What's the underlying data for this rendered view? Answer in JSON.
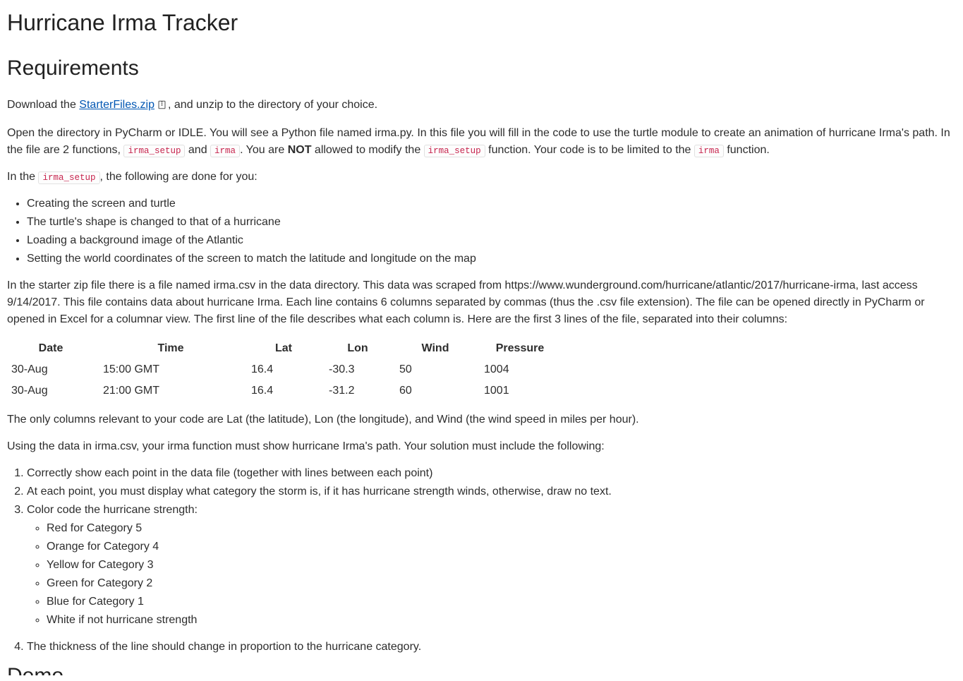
{
  "title": "Hurricane Irma Tracker",
  "heading_requirements": "Requirements",
  "p_download_pre": "Download the ",
  "link_starter": "StarterFiles.zip",
  "p_download_post": ", and unzip to the directory of your choice.",
  "p_open_pre": "Open the directory in PyCharm or IDLE. You will see a Python file named irma.py. In this file you will fill in the code to use the turtle module to create an animation of hurricane Irma's path. In the file are 2 functions, ",
  "code_irma_setup": "irma_setup",
  "p_open_mid1": " and ",
  "code_irma": "irma",
  "p_open_mid2": ". You are ",
  "bold_not": "NOT",
  "p_open_mid3": " allowed to modify the ",
  "p_open_mid4": " function. Your code is to be limited to the ",
  "p_open_end": " function.",
  "p_inthe_pre": "In the ",
  "p_inthe_post": ", the following are done for you:",
  "setup_items": [
    "Creating the screen and turtle",
    "The turtle's shape is changed to that of a hurricane",
    "Loading a background image of the Atlantic",
    "Setting the world coordinates of the screen to match the latitude and longitude on the map"
  ],
  "p_csv": "In the starter zip file there is a file named irma.csv in the data directory. This data was scraped from https://www.wunderground.com/hurricane/atlantic/2017/hurricane-irma, last access 9/14/2017. This file contains data about hurricane Irma. Each line contains 6 columns separated by commas (thus the .csv file extension). The file can be opened directly in PyCharm or opened in Excel for a columnar view. The first line of the file describes what each column is. Here are the first 3 lines of the file, separated into their columns:",
  "table_headers": [
    "Date",
    "Time",
    "Lat",
    "Lon",
    "Wind",
    "Pressure"
  ],
  "table_rows": [
    [
      "30-Aug",
      "15:00 GMT",
      "16.4",
      "-30.3",
      "50",
      "1004"
    ],
    [
      "30-Aug",
      "21:00 GMT",
      "16.4",
      "-31.2",
      "60",
      "1001"
    ]
  ],
  "p_relevant": "The only columns relevant to your code are Lat (the latitude), Lon (the longitude), and Wind (the wind speed in miles per hour).",
  "p_using": "Using the data in irma.csv, your irma function must show hurricane Irma's path. Your solution must include the following:",
  "req_items": {
    "r1": "Correctly show each point in the data file (together with lines between each point)",
    "r2": "At each point, you must display what category the storm is, if it has hurricane strength winds, otherwise, draw no text.",
    "r3": "Color code the hurricane strength:",
    "r4": "The thickness of the line should change in proportion to the hurricane category."
  },
  "color_items": [
    "Red for Category 5",
    "Orange for Category 4",
    "Yellow for Category 3",
    "Green for Category 2",
    "Blue for Category 1",
    "White if not hurricane strength"
  ],
  "partial_demo": "Demo"
}
